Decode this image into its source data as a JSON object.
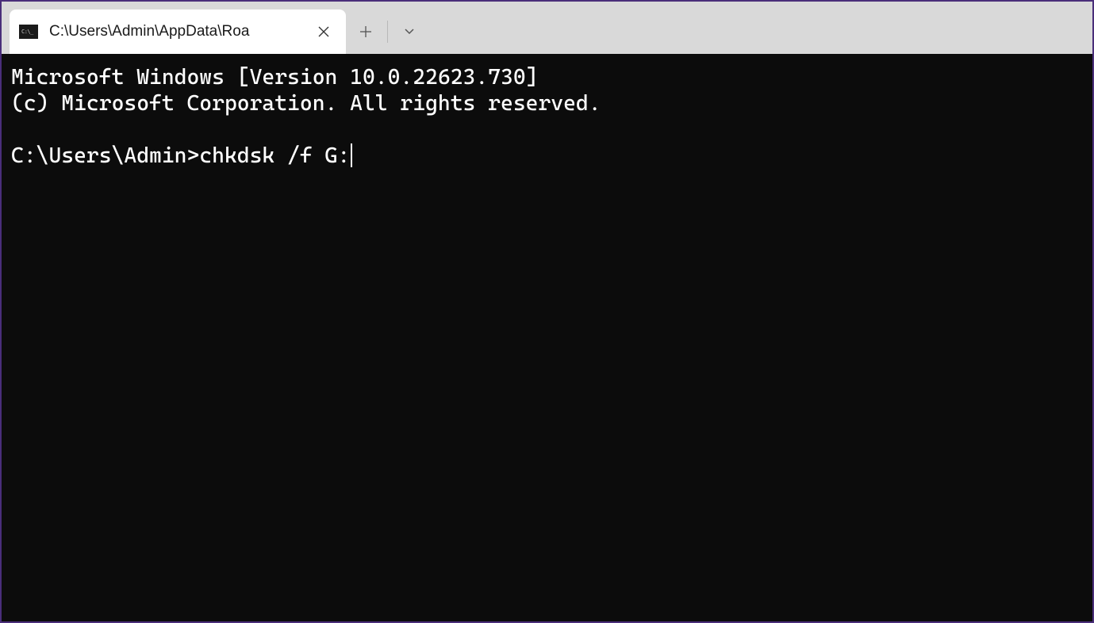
{
  "titlebar": {
    "tab": {
      "title": "C:\\Users\\Admin\\AppData\\Roa",
      "icon_name": "cmd-icon"
    }
  },
  "terminal": {
    "line1": "Microsoft Windows [Version 10.0.22623.730]",
    "line2": "(c) Microsoft Corporation. All rights reserved.",
    "prompt": "C:\\Users\\Admin>",
    "command": "chkdsk /f G:"
  }
}
